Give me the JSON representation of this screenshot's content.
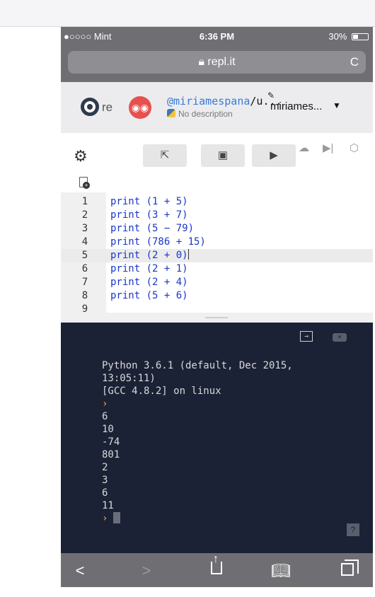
{
  "status_bar": {
    "carrier": "●○○○○ Mint",
    "time": "6:36 PM",
    "battery": "30%",
    "battery_level": 0.3
  },
  "safari": {
    "address": "repl.it"
  },
  "header": {
    "logo_text": "re",
    "username_at": "@miriamespana",
    "username_rest": "/u...",
    "description": "No description",
    "owner": "miriames..."
  },
  "editor": {
    "lines": [
      {
        "n": "1",
        "code": "print (1 + 5)"
      },
      {
        "n": "2",
        "code": "print (3 + 7)"
      },
      {
        "n": "3",
        "code": "print (5 − 79)"
      },
      {
        "n": "4",
        "code": "print (786 + 15)"
      },
      {
        "n": "5",
        "code": "print (2 + 0)"
      },
      {
        "n": "6",
        "code": "print (2 + 1)"
      },
      {
        "n": "7",
        "code": "print (2 + 4)"
      },
      {
        "n": "8",
        "code": "print (5 + 6)"
      },
      {
        "n": "9",
        "code": ""
      }
    ],
    "active_line": 5
  },
  "console": {
    "lines": [
      "Python 3.6.1 (default, Dec 2015,",
      "13:05:11)",
      "[GCC 4.8.2] on linux",
      "›",
      "6",
      "10",
      "-74",
      "801",
      "2",
      "3",
      "6",
      "11"
    ],
    "prompt": "›",
    "help_label": "?"
  },
  "icons": {
    "reload": "C",
    "back": "<",
    "forward": ">"
  }
}
